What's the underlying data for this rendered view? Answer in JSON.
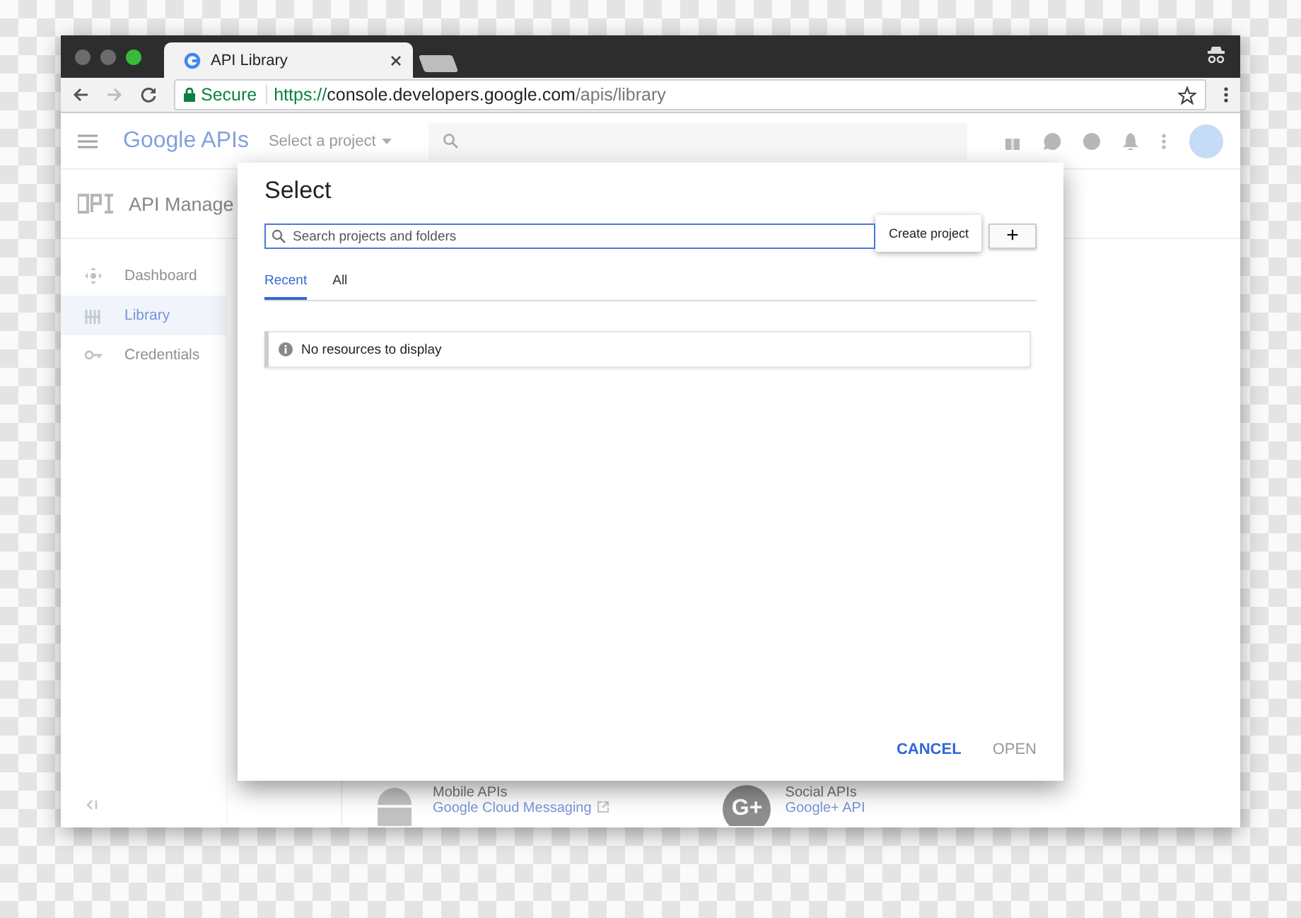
{
  "browser": {
    "tab": {
      "title": "API Library"
    },
    "address": {
      "secure_label": "Secure",
      "scheme": "https://",
      "host": "console.developers.google.com",
      "path": "/apis/library"
    }
  },
  "app_header": {
    "logo": "Google APIs",
    "project_picker": "Select a project"
  },
  "sidebar": {
    "title": "API Manage",
    "items": [
      {
        "label": "Dashboard",
        "kind": "dashboard",
        "selected": false
      },
      {
        "label": "Library",
        "kind": "library",
        "selected": true
      },
      {
        "label": "Credentials",
        "kind": "key",
        "selected": false
      }
    ]
  },
  "cards": [
    {
      "title": "Mobile APIs",
      "link": "Google Cloud Messaging",
      "kind": "android"
    },
    {
      "title": "Social APIs",
      "link": "Google+ API",
      "kind": "gplus",
      "badge": "G+"
    }
  ],
  "dialog": {
    "title": "Select",
    "search": {
      "placeholder": "Search projects and folders"
    },
    "tooltip": "Create project",
    "add_button": "+",
    "tabs": [
      {
        "label": "Recent",
        "selected": true
      },
      {
        "label": "All",
        "selected": false
      }
    ],
    "empty_message": "No resources to display",
    "buttons": [
      {
        "label": "CANCEL",
        "disabled": false
      },
      {
        "label": "OPEN",
        "disabled": true
      }
    ]
  }
}
